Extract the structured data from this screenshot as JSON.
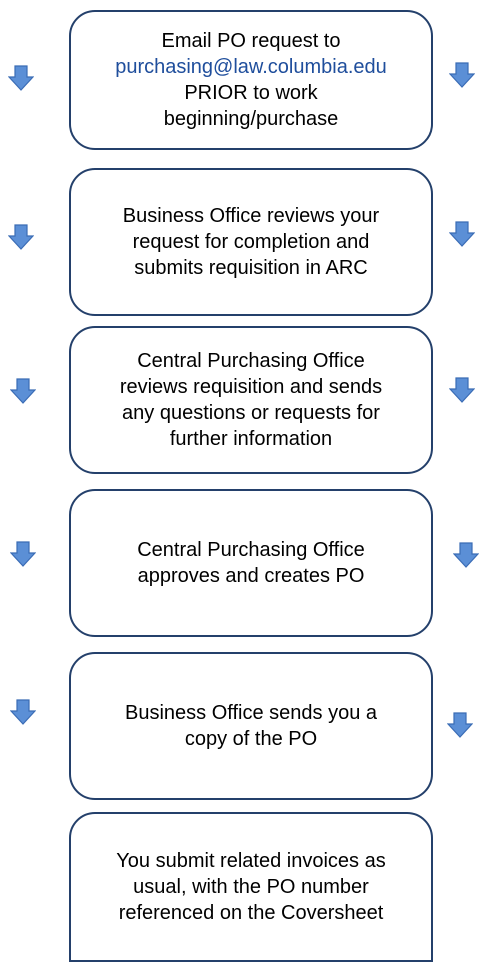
{
  "colors": {
    "box_border": "#24406b",
    "arrow_fill": "#5b8fd6",
    "arrow_stroke": "#3a6cb5",
    "link_text": "#1f4e9c"
  },
  "steps": [
    {
      "lines": [
        "Email PO request to",
        "purchasing@law.columbia.edu",
        "PRIOR to work",
        "beginning/purchase"
      ]
    },
    {
      "lines": [
        "Business Office reviews your",
        "request for completion and",
        "submits requisition in ARC"
      ]
    },
    {
      "lines": [
        "Central Purchasing Office",
        "reviews requisition and sends",
        "any questions or requests for",
        "further information"
      ]
    },
    {
      "lines": [
        "Central Purchasing Office",
        "approves and creates PO"
      ]
    },
    {
      "lines": [
        "Business Office sends you a",
        "copy of the PO"
      ]
    },
    {
      "lines": [
        "You submit related invoices as",
        "usual, with the PO number",
        "referenced on the Coversheet"
      ]
    }
  ]
}
